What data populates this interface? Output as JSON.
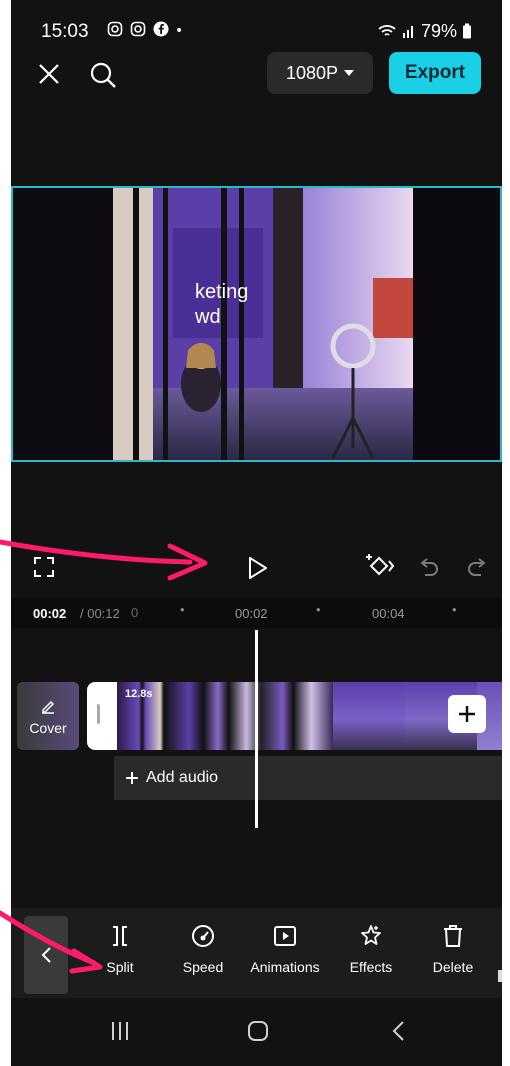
{
  "status": {
    "time": "15:03",
    "notif_icons": [
      "instagram-icon",
      "instagram-icon",
      "facebook-icon"
    ],
    "dot": "•",
    "battery": "79%"
  },
  "topbar": {
    "resolution": "1080P",
    "export_label": "Export"
  },
  "timeline": {
    "current_time": "00:02",
    "total_time": "/ 00:12",
    "ruler_ticks": [
      "00:02",
      "00:04"
    ],
    "clip_duration": "12.8s",
    "cover_label": "Cover",
    "add_audio_label": "Add audio",
    "video_text": "keting\nwd"
  },
  "toolbar": {
    "items": [
      {
        "label": "Split",
        "icon": "split-icon"
      },
      {
        "label": "Speed",
        "icon": "speed-icon"
      },
      {
        "label": "Animations",
        "icon": "animations-icon"
      },
      {
        "label": "Effects",
        "icon": "effects-icon"
      },
      {
        "label": "Delete",
        "icon": "delete-icon"
      }
    ]
  },
  "colors": {
    "accent": "#1ad0e6",
    "annotation_arrow": "#ff1a6b",
    "background": "#121212"
  }
}
